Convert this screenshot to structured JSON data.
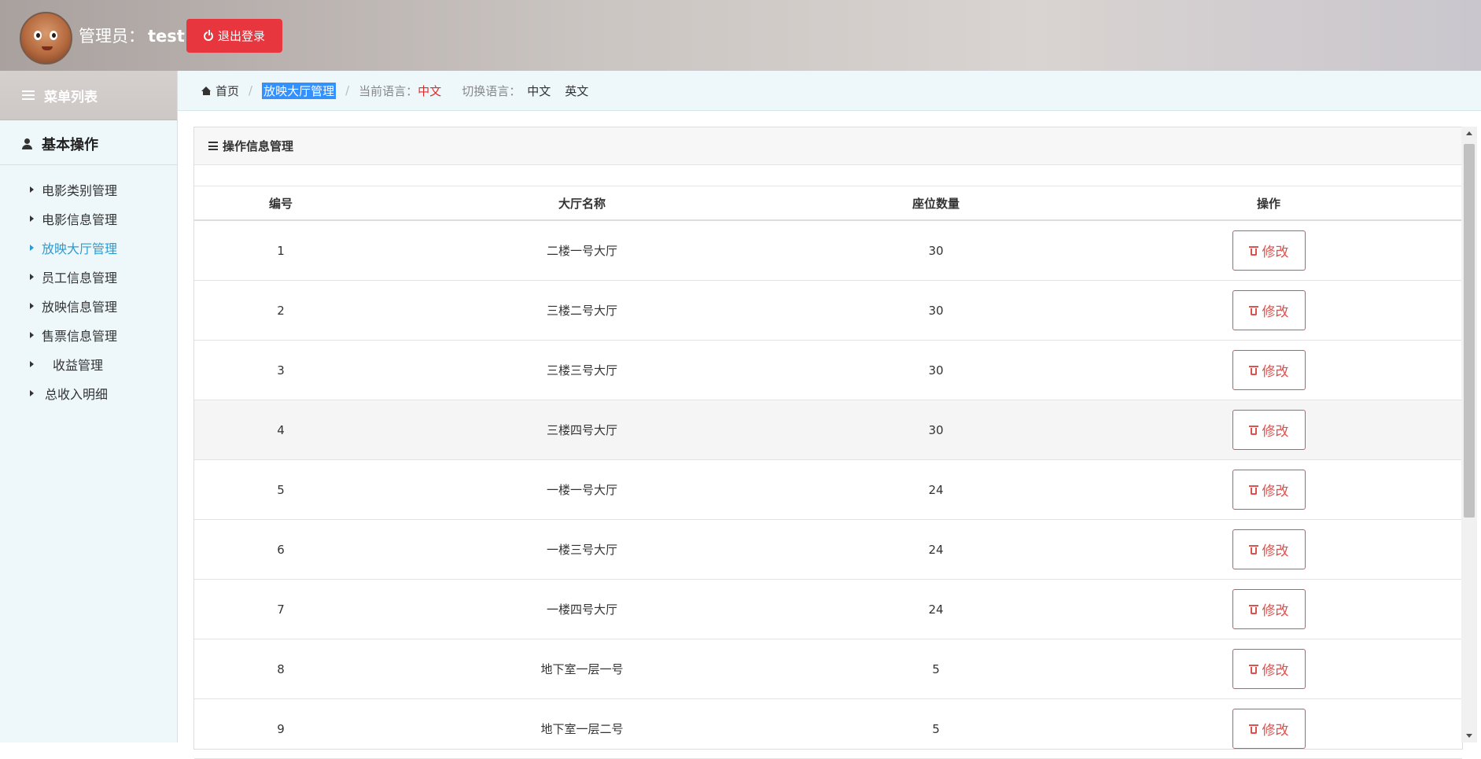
{
  "header": {
    "admin_label": "管理员：",
    "username": "test",
    "logout_label": "退出登录"
  },
  "sidebar": {
    "menu_title": "菜单列表",
    "section_title": "基本操作",
    "items": [
      {
        "label": "电影类别管理",
        "active": false
      },
      {
        "label": "电影信息管理",
        "active": false
      },
      {
        "label": "放映大厅管理",
        "active": true
      },
      {
        "label": "员工信息管理",
        "active": false
      },
      {
        "label": "放映信息管理",
        "active": false
      },
      {
        "label": "售票信息管理",
        "active": false
      },
      {
        "label": "收益管理",
        "active": false
      },
      {
        "label": "总收入明细",
        "active": false
      }
    ]
  },
  "breadcrumb": {
    "home": "首页",
    "current": "放映大厅管理",
    "current_lang_label": "当前语言：",
    "current_lang": "中文",
    "switch_lang_label": "切换语言：",
    "lang_options": [
      "中文",
      "英文"
    ]
  },
  "panel": {
    "title": "操作信息管理",
    "columns": [
      "编号",
      "大厅名称",
      "座位数量",
      "操作"
    ],
    "edit_label": "修改",
    "rows": [
      {
        "id": "1",
        "name": "二楼一号大厅",
        "seats": "30"
      },
      {
        "id": "2",
        "name": "三楼二号大厅",
        "seats": "30"
      },
      {
        "id": "3",
        "name": "三楼三号大厅",
        "seats": "30"
      },
      {
        "id": "4",
        "name": "三楼四号大厅",
        "seats": "30"
      },
      {
        "id": "5",
        "name": "一楼一号大厅",
        "seats": "24"
      },
      {
        "id": "6",
        "name": "一楼三号大厅",
        "seats": "24"
      },
      {
        "id": "7",
        "name": "一楼四号大厅",
        "seats": "24"
      },
      {
        "id": "8",
        "name": "地下室一层一号",
        "seats": "5"
      },
      {
        "id": "9",
        "name": "地下室一层二号",
        "seats": "5"
      }
    ]
  },
  "colors": {
    "logout_bg": "#e8363e",
    "active_nav": "#2b9bd1",
    "edit_button": "#d9534f",
    "lang_current": "#e12b2b",
    "breadcrumb_highlight": "#3390ff"
  }
}
